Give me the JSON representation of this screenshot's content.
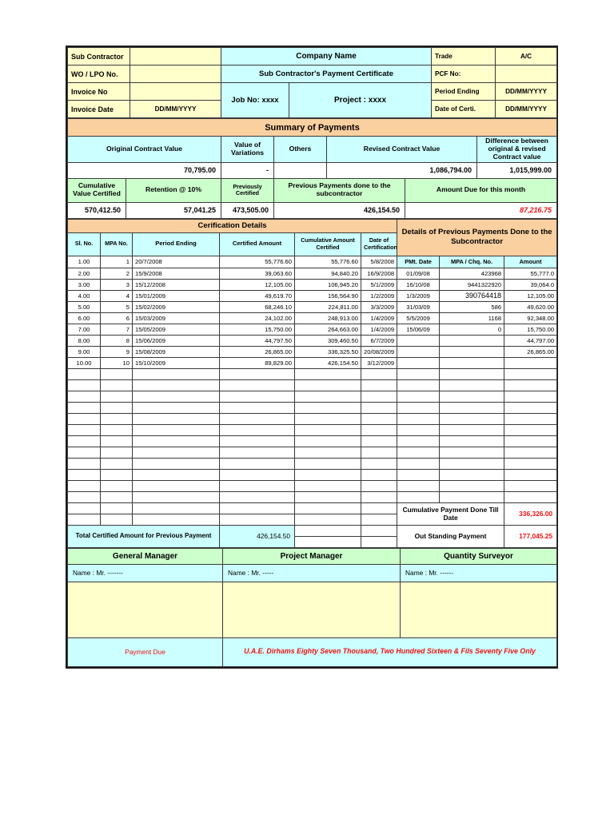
{
  "header": {
    "rows": [
      {
        "label": "Sub Contractor",
        "value": ""
      },
      {
        "label": "WO / LPO No.",
        "value": ""
      },
      {
        "label": "Invoice No",
        "value": ""
      },
      {
        "label": "Invoice Date",
        "value": "DD/MM/YYYY"
      }
    ],
    "company_name": "Company Name",
    "certificate_title": "Sub Contractor's Payment Certificate",
    "job_no": "Job No: xxxx",
    "project": "Project : xxxx",
    "right_rows": [
      {
        "label": "Trade",
        "value": "A/C"
      },
      {
        "label": "PCF No:",
        "value": ""
      },
      {
        "label": "Period Ending",
        "value": "DD/MM/YYYY"
      },
      {
        "label": "Date of Certi.",
        "value": "DD/MM/YYYY"
      }
    ]
  },
  "summary": {
    "title": "Summary of Payments",
    "contract_headers": [
      "Original Contract Value",
      "Value of Variations",
      "Others",
      "Revised Contract Value",
      "Difference between original & revised Contract value"
    ],
    "contract_values": [
      "70,795.00",
      "-",
      "",
      "1,086,794.00",
      "1,015,999.00"
    ],
    "payment_headers": [
      "Cumulative Value Certified",
      "Retention @ 10%",
      "Previously Certified",
      "Previous Payments done to the subcontractor",
      "Amount Due for this month"
    ],
    "payment_values": [
      "570,412.50",
      "57,041.25",
      "473,505.00",
      "426,154.50",
      "87,216.75"
    ]
  },
  "certification": {
    "section_title": "Cerification Details",
    "columns": [
      "Sl. No.",
      "MPA No.",
      "Period Ending",
      "Certified Amount",
      "Cumulative Amount Certified",
      "Date of Certification"
    ],
    "rows": [
      {
        "sl": "1.00",
        "mpa": "1",
        "period": "20/7/2008",
        "certified": "55,776.60",
        "cumulative": "55,776.60",
        "date": "5/8/2008"
      },
      {
        "sl": "2.00",
        "mpa": "2",
        "period": "15/9/2008",
        "certified": "39,063.60",
        "cumulative": "94,840.20",
        "date": "16/9/2008"
      },
      {
        "sl": "3.00",
        "mpa": "3",
        "period": "15/12/2008",
        "certified": "12,105.00",
        "cumulative": "106,945.20",
        "date": "5/1/2009"
      },
      {
        "sl": "4.00",
        "mpa": "4",
        "period": "15/01/2009",
        "certified": "49,619.70",
        "cumulative": "156,564.90",
        "date": "1/2/2009"
      },
      {
        "sl": "5.00",
        "mpa": "5",
        "period": "15/02/2009",
        "certified": "68,246.10",
        "cumulative": "224,811.00",
        "date": "3/3/2009"
      },
      {
        "sl": "6.00",
        "mpa": "6",
        "period": "15/03/2009",
        "certified": "24,102.00",
        "cumulative": "248,913.00",
        "date": "1/4/2009"
      },
      {
        "sl": "7.00",
        "mpa": "7",
        "period": "15/05/2009",
        "certified": "15,750.00",
        "cumulative": "264,663.00",
        "date": "1/4/2009"
      },
      {
        "sl": "8.00",
        "mpa": "8",
        "period": "15/06/2009",
        "certified": "44,797.50",
        "cumulative": "309,460.50",
        "date": "6/7/2009"
      },
      {
        "sl": "9.00",
        "mpa": "9",
        "period": "15/08/2009",
        "certified": "26,865.00",
        "cumulative": "336,325.50",
        "date": "20/08/2009"
      },
      {
        "sl": "10.00",
        "mpa": "10",
        "period": "15/10/2009",
        "certified": "89,829.00",
        "cumulative": "426,154.50",
        "date": "3/12/2009"
      }
    ],
    "empty_row_count": 12
  },
  "previous_payments": {
    "section_title": "Details of Previous Payments Done to the Subcontractor",
    "columns": [
      "PMt. Date",
      "MPA / Chq. No.",
      "Amount"
    ],
    "rows": [
      {
        "date": "01/09/08",
        "chq": "423968",
        "amount": "55,777.0"
      },
      {
        "date": "16/10/08",
        "chq": "9441322920",
        "amount": "39,064.0"
      },
      {
        "date": "1/3/2009",
        "chq": "390764418",
        "amount": "12,105.00"
      },
      {
        "date": "31/03/09",
        "chq": "586",
        "amount": "49,620.00"
      },
      {
        "date": "5/5/2009",
        "chq": "1168",
        "amount": "92,348.00"
      },
      {
        "date": "15/06/09",
        "chq": "0",
        "amount": "15,750.00"
      },
      {
        "date": "",
        "chq": "",
        "amount": "44,797.00"
      },
      {
        "date": "",
        "chq": "",
        "amount": "26,865.00"
      },
      {
        "date": "",
        "chq": "",
        "amount": ""
      },
      {
        "date": "",
        "chq": "",
        "amount": ""
      }
    ]
  },
  "totals": {
    "total_certified_label": "Total Certified Amount for Previous Payment",
    "total_certified_value": "426,154.50",
    "cumulative_label": "Cumulative Payment Done Till Date",
    "cumulative_value": "336,326.00",
    "outstanding_label": "Out Standing Payment",
    "outstanding_value": "177,045.25"
  },
  "signatures": {
    "roles": [
      "General Manager",
      "Project Manager",
      "Quantity Surveyor"
    ],
    "names": [
      "Name : Mr. -------",
      "Name : Mr. -----",
      "Name : Mr. ------"
    ]
  },
  "payment_due": {
    "label": "Payment Due",
    "amount_in_words": "U.A.E. Dirhams Eighty Seven Thousand, Two Hundred Sixteen & Fils Seventy Five Only"
  },
  "colors": {
    "cream": "#ffffcc",
    "cyan": "#ccffff",
    "orange": "#fad0a0",
    "green": "#ccffcc",
    "red": "#ee1111"
  }
}
